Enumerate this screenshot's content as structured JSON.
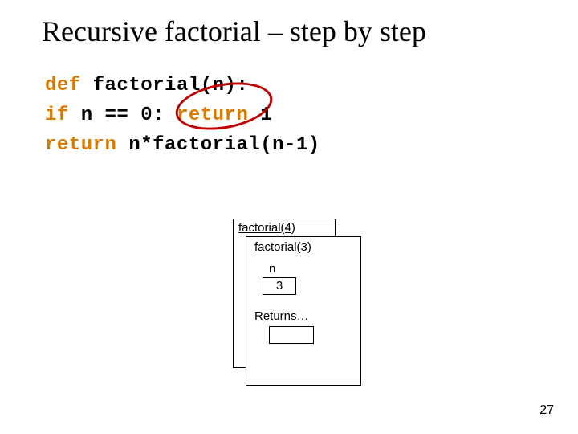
{
  "title": "Recursive factorial – step by step",
  "code": {
    "line1": {
      "kw": "def",
      "rest": " factorial(n):"
    },
    "line2": {
      "indent": "    ",
      "kw1": "if",
      "mid": " n == 0: ",
      "kw2": "return",
      "num": " 1"
    },
    "line3": {
      "indent": "    ",
      "kw": "return",
      "rest": " n*factorial(n-1)"
    }
  },
  "stack": {
    "back_title": "factorial(4)",
    "front_title": "factorial(3)",
    "var_label": "n",
    "var_value": "3",
    "returns_label": "Returns…",
    "returns_value": ""
  },
  "page_number": "27"
}
